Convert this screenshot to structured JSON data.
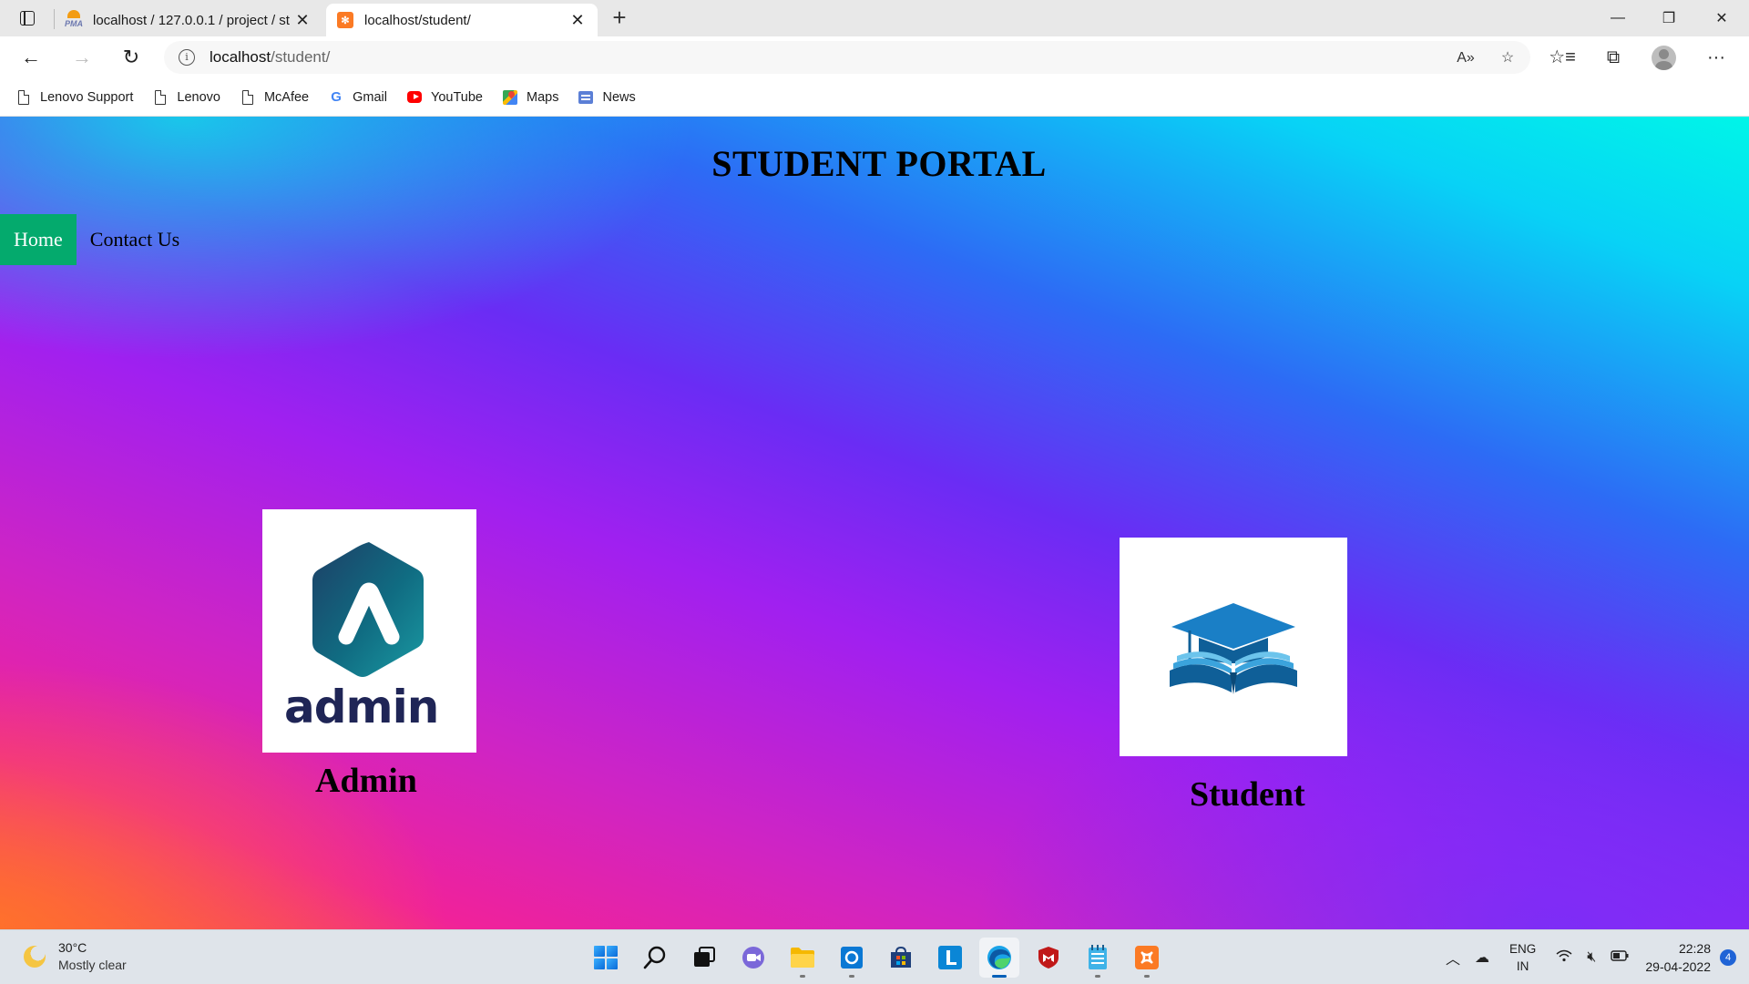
{
  "browser": {
    "tabs": [
      {
        "title": "localhost / 127.0.0.1 / project / st",
        "favicon": "phpmyadmin-icon"
      },
      {
        "title": "localhost/student/",
        "favicon": "xampp-icon"
      }
    ],
    "address": {
      "host": "localhost",
      "path": "/student/"
    },
    "bookmarks": [
      {
        "label": "Lenovo Support",
        "icon": "page-icon"
      },
      {
        "label": "Lenovo",
        "icon": "page-icon"
      },
      {
        "label": "McAfee",
        "icon": "page-icon"
      },
      {
        "label": "Gmail",
        "icon": "google-icon"
      },
      {
        "label": "YouTube",
        "icon": "youtube-icon"
      },
      {
        "label": "Maps",
        "icon": "maps-icon"
      },
      {
        "label": "News",
        "icon": "news-icon"
      }
    ]
  },
  "page": {
    "title": "STUDENT PORTAL",
    "nav": [
      {
        "label": "Home",
        "active": true
      },
      {
        "label": "Contact Us",
        "active": false
      }
    ],
    "cards": {
      "admin": {
        "label": "Admin",
        "logo_text": "admin"
      },
      "student": {
        "label": "Student"
      }
    },
    "colors": {
      "nav_active": "#04aa6d",
      "admin_logo": "#1f2556",
      "student_logo": "#1a7fc6"
    }
  },
  "taskbar": {
    "weather": {
      "temp": "30°C",
      "condition": "Mostly clear"
    },
    "lang": {
      "line1": "ENG",
      "line2": "IN"
    },
    "clock": {
      "time": "22:28",
      "date": "29-04-2022"
    },
    "notifications": "4"
  }
}
